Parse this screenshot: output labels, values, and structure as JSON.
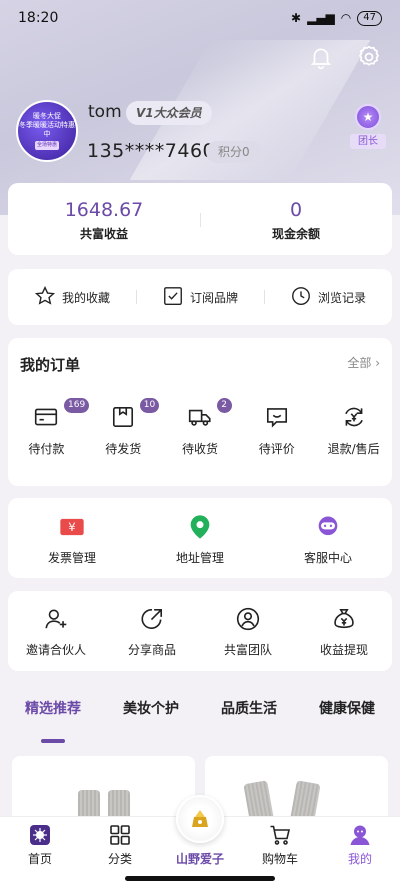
{
  "status": {
    "time": "18:20",
    "battery": "47"
  },
  "profile": {
    "username": "tom",
    "vip_label": "V1大众会员",
    "phone": "135****7460",
    "points": "积分0",
    "leader_label": "团长",
    "avatar_text_1": "暖冬大促",
    "avatar_text_2": "冬季暖暖活动特惠中",
    "avatar_text_3": "全场特惠"
  },
  "earnings": [
    {
      "value": "1648.67",
      "label": "共富收益"
    },
    {
      "value": "0",
      "label": "现金余额"
    }
  ],
  "quick_links": [
    {
      "label": "我的收藏",
      "icon": "star-icon"
    },
    {
      "label": "订阅品牌",
      "icon": "checkbox-icon"
    },
    {
      "label": "浏览记录",
      "icon": "clock-icon"
    }
  ],
  "orders": {
    "title": "我的订单",
    "all_label": "全部",
    "items": [
      {
        "label": "待付款",
        "badge": "169",
        "icon": "wallet-icon"
      },
      {
        "label": "待发货",
        "badge": "10",
        "icon": "package-icon"
      },
      {
        "label": "待收货",
        "badge": "2",
        "icon": "truck-icon"
      },
      {
        "label": "待评价",
        "badge": "",
        "icon": "comment-icon"
      },
      {
        "label": "退款/售后",
        "badge": "",
        "icon": "refund-icon"
      }
    ]
  },
  "tools": [
    {
      "label": "发票管理",
      "icon": "invoice-icon"
    },
    {
      "label": "地址管理",
      "icon": "location-icon"
    },
    {
      "label": "客服中心",
      "icon": "customer-service-icon"
    }
  ],
  "team_tools": [
    {
      "label": "邀请合伙人",
      "icon": "add-user-icon"
    },
    {
      "label": "分享商品",
      "icon": "share-icon"
    },
    {
      "label": "共富团队",
      "icon": "team-icon"
    },
    {
      "label": "收益提现",
      "icon": "money-bag-icon"
    }
  ],
  "category_tabs": [
    "精选推荐",
    "美妆个护",
    "品质生活",
    "健康保健"
  ],
  "tabbar": [
    {
      "label": "首页",
      "icon": "home-icon"
    },
    {
      "label": "分类",
      "icon": "grid-icon"
    },
    {
      "label": "山野爱子",
      "icon": "brand-icon"
    },
    {
      "label": "购物车",
      "icon": "cart-icon"
    },
    {
      "label": "我的",
      "icon": "user-icon"
    }
  ],
  "colors": {
    "accent": "#6b4aa8",
    "badge": "#7a5aa3",
    "leader": "#8a56d6"
  }
}
